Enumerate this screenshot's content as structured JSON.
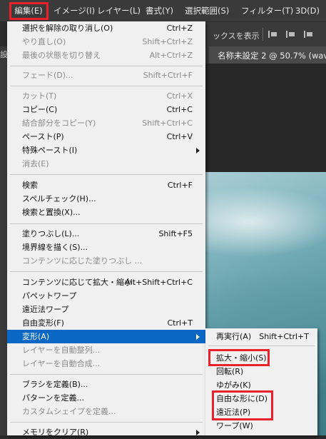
{
  "menubar": {
    "items": [
      "編集(E)",
      "イメージ(I)",
      "レイヤー(L)",
      "書式(Y)",
      "選択範囲(S)",
      "フィルター(T)",
      "3D(D)"
    ]
  },
  "options_bar": {
    "text": "ックスを表示"
  },
  "left_tab": {
    "text": "設"
  },
  "document_tab": {
    "label": "名称未設定 2 @ 50.7% (wav"
  },
  "edit_menu": {
    "items": [
      {
        "label": "選択を解除の取り消し(O)",
        "shortcut": "Ctrl+Z"
      },
      {
        "label": "やり直し(O)",
        "shortcut": "Shift+Ctrl+Z"
      },
      {
        "label": "最後の状態を切り替え",
        "shortcut": "Alt+Ctrl+Z"
      },
      {
        "label": "フェード(D)...",
        "shortcut": "Shift+Ctrl+F"
      },
      {
        "label": "カット(T)",
        "shortcut": "Ctrl+X"
      },
      {
        "label": "コピー(C)",
        "shortcut": "Ctrl+C"
      },
      {
        "label": "結合部分をコピー(Y)",
        "shortcut": "Shift+Ctrl+C"
      },
      {
        "label": "ペースト(P)",
        "shortcut": "Ctrl+V"
      },
      {
        "label": "特殊ペースト(I)",
        "shortcut": ""
      },
      {
        "label": "消去(E)",
        "shortcut": ""
      },
      {
        "label": "検索",
        "shortcut": "Ctrl+F"
      },
      {
        "label": "スペルチェック(H)...",
        "shortcut": ""
      },
      {
        "label": "検索と置換(X)...",
        "shortcut": ""
      },
      {
        "label": "塗りつぶし(L)...",
        "shortcut": "Shift+F5"
      },
      {
        "label": "境界線を描く(S)...",
        "shortcut": ""
      },
      {
        "label": "コンテンツに応じた塗りつぶし ...",
        "shortcut": ""
      },
      {
        "label": "コンテンツに応じて拡大・縮小",
        "shortcut": "Alt+Shift+Ctrl+C"
      },
      {
        "label": "パペットワープ",
        "shortcut": ""
      },
      {
        "label": "遠近法ワープ",
        "shortcut": ""
      },
      {
        "label": "自由変形(F)",
        "shortcut": "Ctrl+T"
      },
      {
        "label": "変形(A)",
        "shortcut": ""
      },
      {
        "label": "レイヤーを自動整列...",
        "shortcut": ""
      },
      {
        "label": "レイヤーを自動合成...",
        "shortcut": ""
      },
      {
        "label": "ブラシを定義(B)...",
        "shortcut": ""
      },
      {
        "label": "パターンを定義...",
        "shortcut": ""
      },
      {
        "label": "カスタムシェイプを定義...",
        "shortcut": ""
      },
      {
        "label": "メモリをクリア(R)",
        "shortcut": ""
      }
    ]
  },
  "transform_submenu": {
    "items": [
      {
        "label": "再実行(A)",
        "shortcut": "Shift+Ctrl+T"
      },
      {
        "label": "拡大・縮小(S)",
        "shortcut": ""
      },
      {
        "label": "回転(R)",
        "shortcut": ""
      },
      {
        "label": "ゆがみ(K)",
        "shortcut": ""
      },
      {
        "label": "自由な形に(D)",
        "shortcut": ""
      },
      {
        "label": "遠近法(P)",
        "shortcut": ""
      },
      {
        "label": "ワープ(W)",
        "shortcut": ""
      }
    ]
  },
  "colors": {
    "highlight": "#0a67c4",
    "annotation_red": "#e8212b",
    "menu_bg": "#f0f0f0",
    "menubar_bg": "#3a3a3a"
  }
}
